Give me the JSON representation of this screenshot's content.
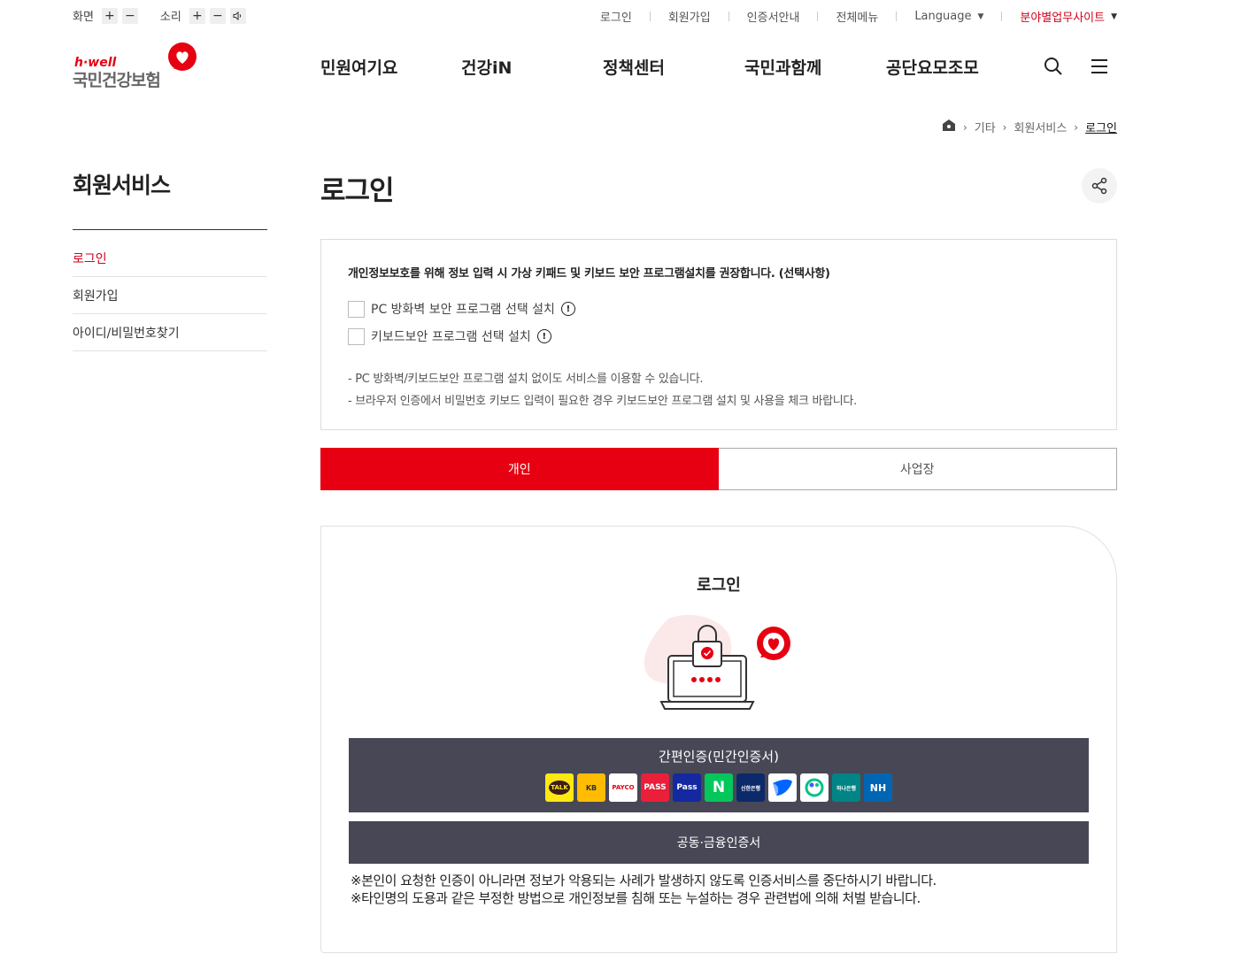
{
  "util": {
    "screen_label": "화면",
    "sound_label": "소리",
    "plus": "+",
    "minus": "−",
    "links": [
      "로그인",
      "회원가입",
      "인증서안내",
      "전체메뉴",
      "Language",
      "분야별업무사이트"
    ]
  },
  "logo": {
    "top": "h·well",
    "name": "국민건강보험"
  },
  "gnb": [
    "민원여기요",
    "건강iN",
    "정책센터",
    "국민과함께",
    "공단요모조모"
  ],
  "breadcrumb": [
    "기타",
    "회원서비스",
    "로그인"
  ],
  "sidebar": {
    "title": "회원서비스",
    "items": [
      "로그인",
      "회원가입",
      "아이디/비밀번호찾기"
    ]
  },
  "page_title": "로그인",
  "notice": {
    "head": "개인정보보호를 위해 정보 입력 시 가상 키패드 및 키보드 보안 프로그램설치를 권장합니다. (선택사항)",
    "check1": "PC 방화벽 보안 프로그램 선택 설치",
    "check2": "키보드보안 프로그램 선택 설치",
    "note1": "- PC 방화벽/키보드보안 프로그램 설치 없이도 서비스를 이용할 수 있습니다.",
    "note2": "- 브라우저 인증에서 비밀번호 키보드 입력이 필요한 경우 키보드보안 프로그램 설치 및 사용을 체크 바랍니다."
  },
  "tabs": [
    "개인",
    "사업장"
  ],
  "login": {
    "title": "로그인",
    "simple_auth": "간편인증(민간인증서)",
    "cert_auth": "공동·금융인증서",
    "providers": [
      "TALK",
      "KB",
      "PAYCO",
      "PASS",
      "Pass",
      "N",
      "신한은행",
      "toss",
      "뱅크샐러드",
      "하나은행",
      "NH"
    ],
    "warn1": "※본인이 요청한 인증이 아니라면 정보가 악용되는 사례가 발생하지 않도록 인증서비스를 중단하시기 바랍니다.",
    "warn2": "※타인명의 도용과 같은 부정한 방법으로 개인정보를 침해 또는 누설하는 경우 관련법에 의해 처벌 받습니다."
  },
  "colors": {
    "brand_red": "#e60012",
    "dark_button": "#474756"
  }
}
